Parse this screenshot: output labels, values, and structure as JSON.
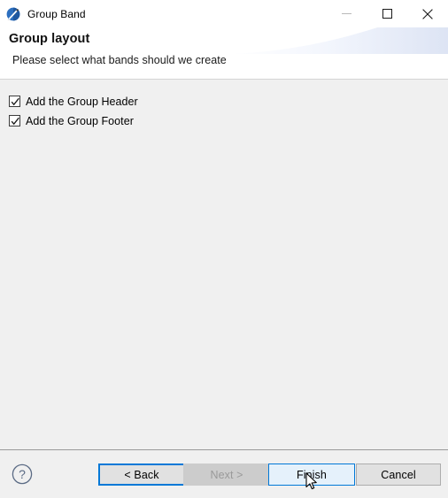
{
  "window": {
    "title": "Group Band",
    "icon": "jasper-band-icon",
    "controls": {
      "minimize_label": "Minimize",
      "minimize_icon": "minimize-icon",
      "maximize_label": "Maximize",
      "maximize_icon": "maximize-icon",
      "close_label": "Close",
      "close_icon": "close-icon"
    }
  },
  "header": {
    "title": "Group layout",
    "subtitle": "Please select what bands should we create",
    "banner_accent_color": "#dfe5f5"
  },
  "content": {
    "options": [
      {
        "label": "Add the Group Header",
        "checked": true,
        "name": "add-group-header"
      },
      {
        "label": "Add the Group Footer",
        "checked": true,
        "name": "add-group-footer"
      }
    ]
  },
  "buttonbar": {
    "help_icon": "help-icon",
    "buttons": [
      {
        "label": "< Back",
        "name": "back-button",
        "state": "focused",
        "enabled": true
      },
      {
        "label": "Next >",
        "name": "next-button",
        "state": "disabled",
        "enabled": false
      },
      {
        "label": "Finish",
        "name": "finish-button",
        "state": "hovered",
        "enabled": true
      },
      {
        "label": "Cancel",
        "name": "cancel-button",
        "state": "normal",
        "enabled": true
      }
    ]
  },
  "colors": {
    "accent": "#0078d7",
    "hover_fill": "#e5f1fb",
    "dialog_bg": "#f0f0f0",
    "button_face": "#e1e1e1",
    "disabled_text": "#9a9a9a"
  },
  "cursor": {
    "type": "arrow-pointer",
    "over": "finish-button"
  }
}
